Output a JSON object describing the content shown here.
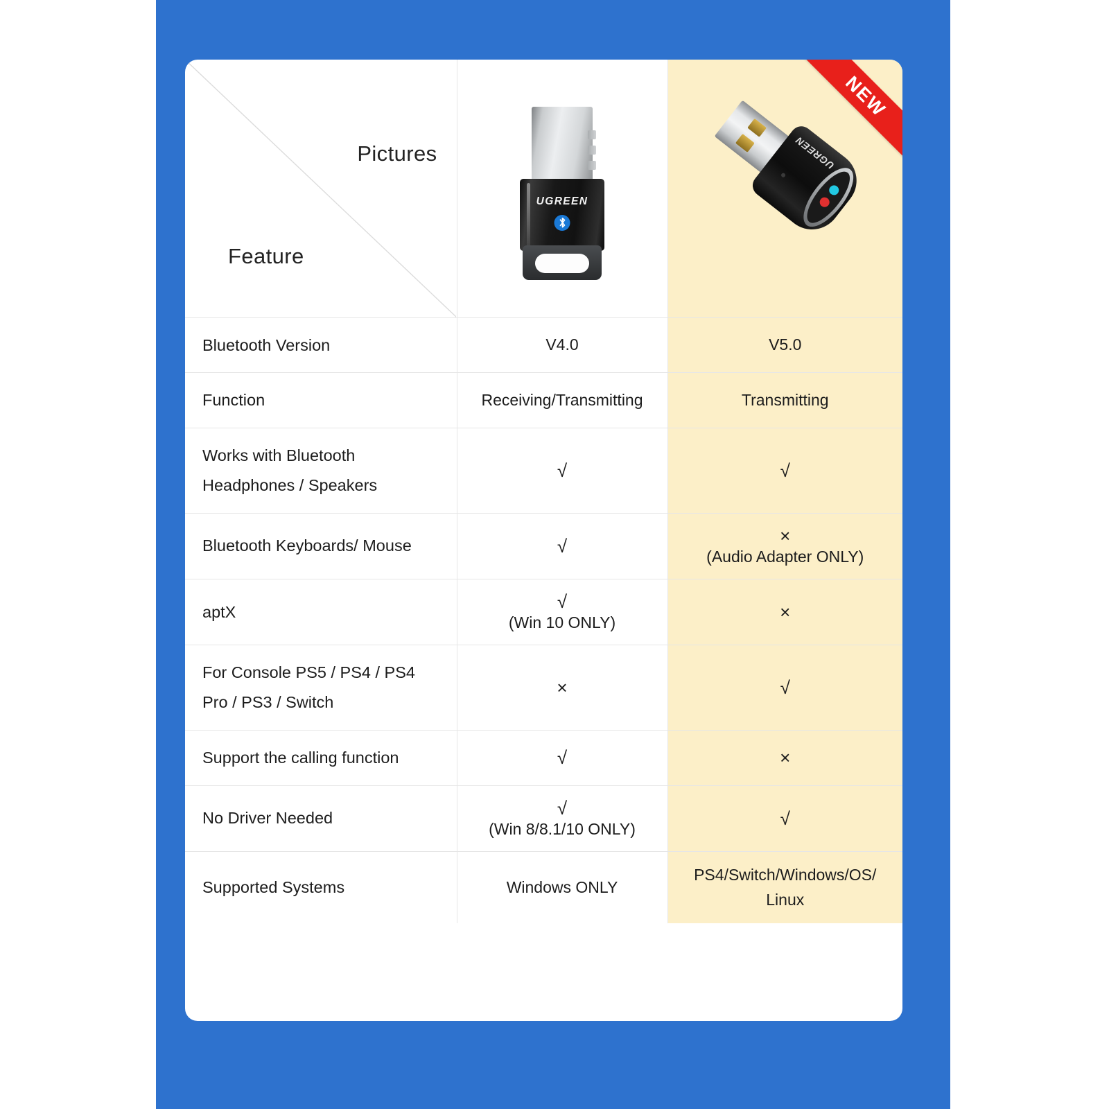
{
  "theme": {
    "background_blue": "#2E72CE",
    "card_white": "#FFFFFF",
    "highlight_cream": "#FCEFC8",
    "ribbon_red": "#E8201B",
    "text_dark": "#1E1E1E",
    "grid_line": "#E6E6E6"
  },
  "header": {
    "pictures_label": "Pictures",
    "feature_label": "Feature",
    "ribbon_label": "NEW"
  },
  "products": [
    {
      "id": "product-a",
      "brand": "UGREEN",
      "badge": "",
      "highlighted": false
    },
    {
      "id": "product-b",
      "brand": "UGREEN",
      "badge": "NEW",
      "highlighted": true
    }
  ],
  "symbols": {
    "check": "√",
    "cross": "×"
  },
  "table": {
    "columns": [
      "Feature",
      "Pictures A",
      "Pictures B"
    ],
    "rows": [
      {
        "feature": "Bluetooth Version",
        "a": {
          "main": "V4.0",
          "note": ""
        },
        "b": {
          "main": "V5.0",
          "note": ""
        }
      },
      {
        "feature": "Function",
        "a": {
          "main": "Receiving/Transmitting",
          "note": ""
        },
        "b": {
          "main": "Transmitting",
          "note": ""
        }
      },
      {
        "feature": "Works with Bluetooth Headphones / Speakers",
        "a": {
          "main": "√",
          "note": ""
        },
        "b": {
          "main": "√",
          "note": ""
        }
      },
      {
        "feature": "Bluetooth Keyboards/ Mouse",
        "a": {
          "main": "√",
          "note": ""
        },
        "b": {
          "main": "×",
          "note": "(Audio Adapter ONLY)"
        }
      },
      {
        "feature": "aptX",
        "a": {
          "main": "√",
          "note": "(Win 10 ONLY)"
        },
        "b": {
          "main": "×",
          "note": ""
        }
      },
      {
        "feature": "For Console PS5 / PS4 / PS4 Pro / PS3 / Switch",
        "a": {
          "main": "×",
          "note": ""
        },
        "b": {
          "main": "√",
          "note": ""
        }
      },
      {
        "feature": "Support the calling function",
        "a": {
          "main": "√",
          "note": ""
        },
        "b": {
          "main": "×",
          "note": ""
        }
      },
      {
        "feature": "No Driver Needed",
        "a": {
          "main": "√",
          "note": "(Win 8/8.1/10 ONLY)"
        },
        "b": {
          "main": "√",
          "note": ""
        }
      },
      {
        "feature": "Supported Systems",
        "a": {
          "main": "Windows ONLY",
          "note": ""
        },
        "b": {
          "main": "PS4/Switch/Windows/OS/ Linux",
          "note": ""
        }
      }
    ]
  }
}
